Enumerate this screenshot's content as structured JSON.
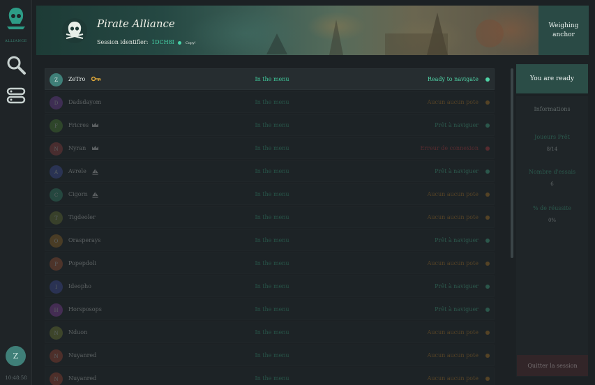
{
  "nav": {
    "logo_label": "ALLIANCE",
    "clock": "10:48:58"
  },
  "user": {
    "initial": "Z"
  },
  "banner": {
    "title": "Pirate Alliance",
    "session_label": "Session identifier:",
    "session_id": "1DCH8I",
    "copy_label": "Copy!"
  },
  "weigh_anchor": "Weighing anchor",
  "players": [
    {
      "initial": "Z",
      "name": "ZeTro",
      "icon": "key-icon",
      "location": "In the menu",
      "status": "Ready to navigate",
      "status_color": "#4fd3a6",
      "avatar_color": "#3f7f78",
      "dim": false
    },
    {
      "initial": "D",
      "name": "Dadsdayom",
      "icon": "",
      "location": "In the menu",
      "status": "Aucun aucun pote",
      "status_color": "#d9912a",
      "avatar_color": "#8e4cc0",
      "dim": true
    },
    {
      "initial": "F",
      "name": "Fricres",
      "icon": "crown-icon",
      "location": "In the menu",
      "status": "Prêt à naviguer",
      "status_color": "#4fd3a6",
      "avatar_color": "#5a9a3a",
      "dim": true
    },
    {
      "initial": "N",
      "name": "Nyran",
      "icon": "crown-icon",
      "location": "In the menu",
      "status": "Erreur de connexion",
      "status_color": "#e0434b",
      "avatar_color": "#b04a4a",
      "dim": true
    },
    {
      "initial": "A",
      "name": "Avrele",
      "icon": "ship-icon",
      "location": "In the menu",
      "status": "Prêt à naviguer",
      "status_color": "#4fd3a6",
      "avatar_color": "#4a5fc0",
      "dim": true
    },
    {
      "initial": "C",
      "name": "Cigorn",
      "icon": "ship-icon",
      "location": "In the menu",
      "status": "Aucun aucun pote",
      "status_color": "#d9912a",
      "avatar_color": "#3aa07e",
      "dim": true
    },
    {
      "initial": "T",
      "name": "Tigdeoler",
      "icon": "",
      "location": "In the menu",
      "status": "Aucun aucun pote",
      "status_color": "#d9912a",
      "avatar_color": "#7a8a3a",
      "dim": true
    },
    {
      "initial": "O",
      "name": "Orasperays",
      "icon": "",
      "location": "In the menu",
      "status": "Prêt à naviguer",
      "status_color": "#4fd3a6",
      "avatar_color": "#b07a2a",
      "dim": true
    },
    {
      "initial": "P",
      "name": "Popepdoli",
      "icon": "",
      "location": "In the menu",
      "status": "Aucun aucun pote",
      "status_color": "#d9912a",
      "avatar_color": "#c0603a",
      "dim": true
    },
    {
      "initial": "I",
      "name": "Ideopho",
      "icon": "",
      "location": "In the menu",
      "status": "Prêt à naviguer",
      "status_color": "#4fd3a6",
      "avatar_color": "#4a5ac0",
      "dim": true
    },
    {
      "initial": "H",
      "name": "Horsposops",
      "icon": "",
      "location": "In the menu",
      "status": "Prêt à naviguer",
      "status_color": "#4fd3a6",
      "avatar_color": "#a04ac0",
      "dim": true
    },
    {
      "initial": "N",
      "name": "Nduon",
      "icon": "",
      "location": "In the menu",
      "status": "Aucun aucun pote",
      "status_color": "#d9912a",
      "avatar_color": "#8a9a3a",
      "dim": true
    },
    {
      "initial": "N",
      "name": "Nuyanred",
      "icon": "",
      "location": "In the menu",
      "status": "Aucun aucun pote",
      "status_color": "#d9912a",
      "avatar_color": "#c0503a",
      "dim": true
    },
    {
      "initial": "N",
      "name": "Nuyanred",
      "icon": "",
      "location": "In the menu",
      "status": "Aucun aucun pote",
      "status_color": "#d9912a",
      "avatar_color": "#c0503a",
      "dim": true
    }
  ],
  "ready_button": "You are ready",
  "info": {
    "title": "Informations",
    "fields": [
      {
        "label": "Joueurs Prêt",
        "value": "8/14"
      },
      {
        "label": "Nombre d'essais",
        "value": "6"
      },
      {
        "label": "% de réussite",
        "value": "0%"
      }
    ]
  },
  "leave_button": "Quitter la session"
}
